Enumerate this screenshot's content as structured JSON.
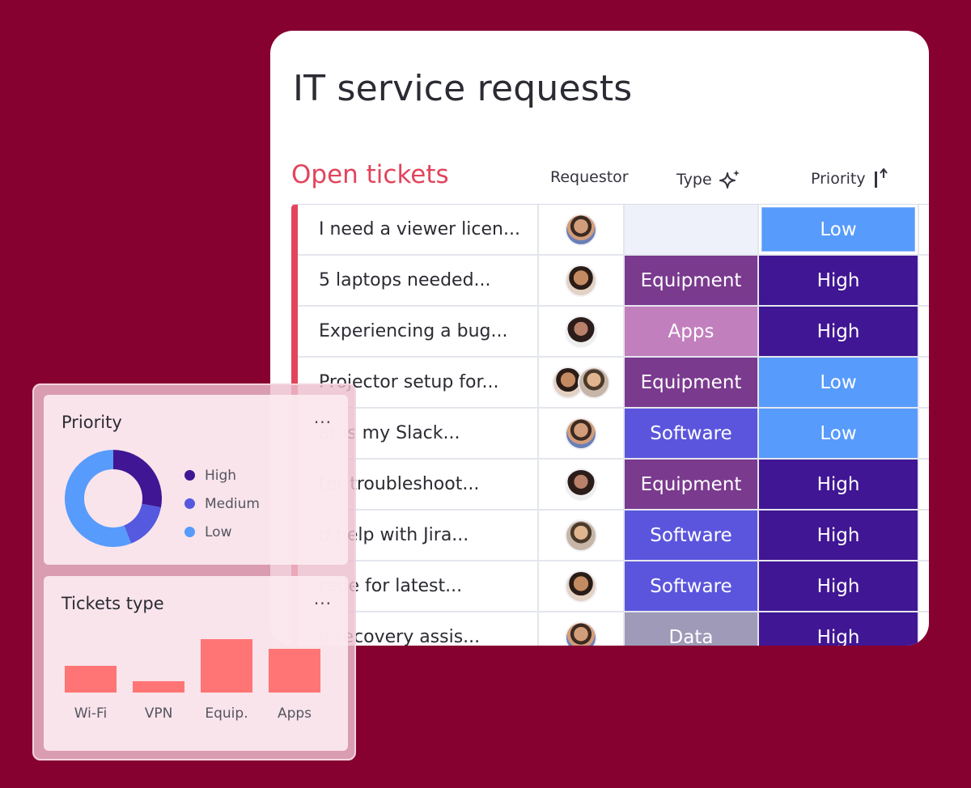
{
  "board": {
    "title": "IT service requests",
    "group_title": "Open tickets",
    "columns": {
      "requestor": "Requestor",
      "type": "Type",
      "priority": "Priority"
    },
    "rows": [
      {
        "name": "I need a viewer licen...",
        "type": "",
        "priority": "Low"
      },
      {
        "name": "5 laptops needed...",
        "type": "Equipment",
        "priority": "High"
      },
      {
        "name": "Experiencing a bug...",
        "type": "Apps",
        "priority": "High"
      },
      {
        "name": "Projector setup for...",
        "type": "Equipment",
        "priority": "Low"
      },
      {
        "name": "at is my Slack...",
        "type": "Software",
        "priority": "Low"
      },
      {
        "name": "ter troubleshoot...",
        "type": "Equipment",
        "priority": "High"
      },
      {
        "name": "d help with Jira...",
        "type": "Software",
        "priority": "High"
      },
      {
        "name": "rade for latest...",
        "type": "Software",
        "priority": "High"
      },
      {
        "name": "n recovery assis...",
        "type": "Data",
        "priority": "High"
      }
    ]
  },
  "colors": {
    "background": "#860030",
    "group": "#e2445c",
    "type_equipment": "#7a3a8e",
    "type_apps": "#c27fbd",
    "type_software": "#5b55dd",
    "type_data": "#9f9ab8",
    "type_empty": "#eef0fa",
    "priority_high": "#401694",
    "priority_low": "#579bfc",
    "bar": "#ff7575"
  },
  "priority_widget": {
    "title": "Priority",
    "menu": "...",
    "legend": [
      {
        "label": "High",
        "color": "#401694"
      },
      {
        "label": "Medium",
        "color": "#5559df"
      },
      {
        "label": "Low",
        "color": "#579bfc"
      }
    ]
  },
  "tickets_widget": {
    "title": "Tickets type",
    "menu": "..."
  },
  "chart_data": [
    {
      "type": "pie",
      "title": "Priority",
      "categories": [
        "High",
        "Medium",
        "Low"
      ],
      "values": [
        28,
        16,
        56
      ]
    },
    {
      "type": "bar",
      "title": "Tickets type",
      "categories": [
        "Wi-Fi",
        "VPN",
        "Equip.",
        "Apps"
      ],
      "values": [
        33,
        14,
        66,
        54
      ]
    }
  ]
}
